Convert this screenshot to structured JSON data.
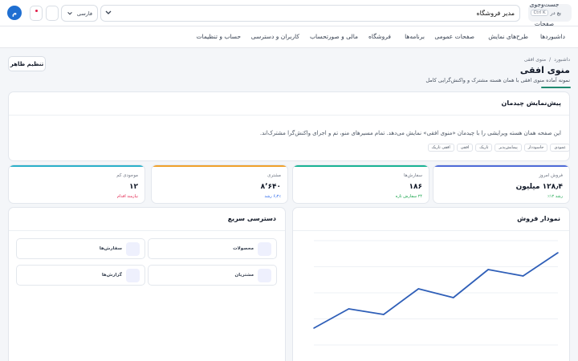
{
  "topbar": {
    "search_value": "مدیر فروشگاه",
    "search_result_line1": "جست‌وجوی",
    "search_result_line2": "یع در",
    "search_result_kbd": "Ctrl K",
    "search_result_line3": "صفحات",
    "language": "فارسی",
    "avatar_initial": "م"
  },
  "nav": {
    "items": [
      "داشبوردها",
      "طرح‌های نمایش",
      "صفحات عمومی",
      "برنامه‌ها",
      "فروشگاه",
      "مالی و صورتحساب",
      "کاربران و دسترسی",
      "حساب و تنظیمات"
    ]
  },
  "page": {
    "breadcrumb_home": "داشبورد",
    "breadcrumb_sep": "/",
    "breadcrumb_current": "منوی افقی",
    "title": "منوی افقی",
    "subtitle": "نمونه آماده منوی افقی با همان هسته مشترک و واکنش‌گرایی کامل",
    "settings_label": "تنظیم ظاهر"
  },
  "preview": {
    "title": "پیش‌نمایش چیدمان",
    "description": "این صفحه همان هسته ویرایشی را با چیدمان «منوی افقی» نمایش می‌دهد. تمام مسیرهای منو، تم و اجرای واکنش‌گرا مشترک‌اند.",
    "chips": [
      "عمودی",
      "جاسوددار",
      "پیمایش‌پذیر",
      "تاریک",
      "افقی",
      "افقی تاریک"
    ]
  },
  "stats": [
    {
      "label": "فروش امروز",
      "value": "۱۲۸٫۴ میلیون",
      "sub": "رشد ۱۲٪",
      "color": "#4f6bd8",
      "sub_color": "#16a34a"
    },
    {
      "label": "سفارش‌ها",
      "value": "۱۸۶",
      "sub": "۲۴ سفارش تازه",
      "color": "#1ab394",
      "sub_color": "#16a34a"
    },
    {
      "label": "مشتری",
      "value": "۸٬۶۴۰",
      "sub": "۶٫۲٪ رشد",
      "color": "#f0a12b",
      "sub_color": "#2563eb"
    },
    {
      "label": "موجودی کم",
      "value": "۱۲",
      "sub": "نیازمند اقدام",
      "color": "#2bb0c9",
      "sub_color": "#e11d48"
    }
  ],
  "sales_chart": {
    "title": "نمودار فروش"
  },
  "quick_access": {
    "title": "دسترسی سریع",
    "tiles": [
      "محصولات",
      "سفارش‌ها",
      "مشتریان",
      "گزارش‌ها"
    ]
  },
  "colors": {
    "accent": "#1f6fd1",
    "line": "#2f5fb8",
    "underline": "#1f8a70"
  },
  "chart_data": {
    "type": "line",
    "title": "",
    "xlabel": "",
    "ylabel": "",
    "x": [
      1,
      2,
      3,
      4,
      5,
      6,
      7,
      8
    ],
    "series": [
      {
        "values": [
          21,
          45,
          38,
          70,
          59,
          94,
          86,
          115
        ]
      }
    ],
    "ylim": [
      0,
      130
    ],
    "grid": true
  }
}
